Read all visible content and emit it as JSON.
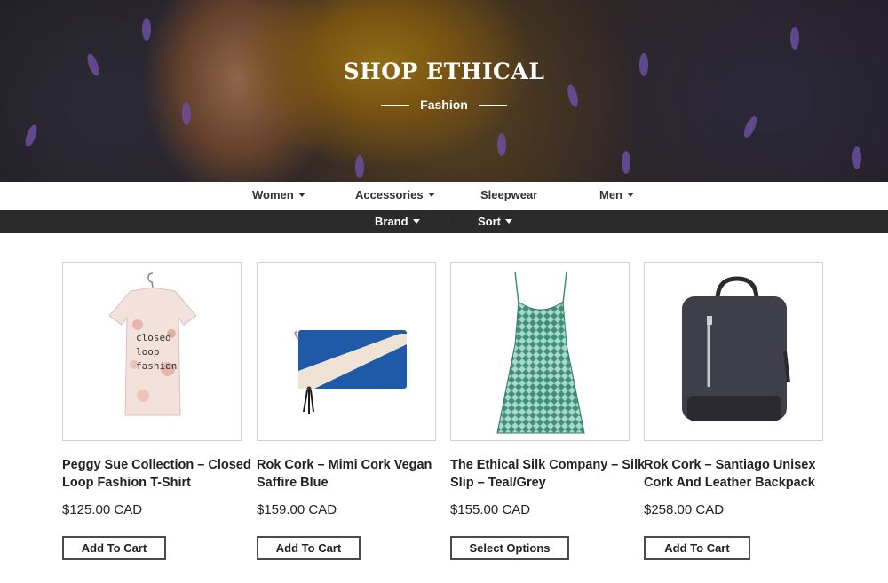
{
  "hero": {
    "title": "SHOP ETHICAL",
    "subtitle": "Fashion"
  },
  "main_nav": {
    "items": [
      {
        "label": "Women",
        "has_dropdown": true
      },
      {
        "label": "Accessories",
        "has_dropdown": true
      },
      {
        "label": "Sleepwear",
        "has_dropdown": false
      },
      {
        "label": "Men",
        "has_dropdown": true
      }
    ]
  },
  "filter_bar": {
    "brand_label": "Brand",
    "separator": "|",
    "sort_label": "Sort"
  },
  "products": [
    {
      "name": "Peggy Sue Collection – Closed Loop Fashion T-Shirt",
      "price": "$125.00 CAD",
      "button": "Add To Cart",
      "image_text": "closed loop fashion",
      "image": "t-shirt"
    },
    {
      "name": "Rok Cork – Mimi Cork Vegan Saffire Blue",
      "price": "$159.00 CAD",
      "button": "Add To Cart",
      "image": "clutch-bag"
    },
    {
      "name": "The Ethical Silk Company – Silk Slip – Teal/Grey",
      "price": "$155.00 CAD",
      "button": "Select Options",
      "image": "silk-slip-dress"
    },
    {
      "name": "Rok Cork – Santiago Unisex Cork And Leather Backpack",
      "price": "$258.00 CAD",
      "button": "Add To Cart",
      "image": "backpack"
    }
  ],
  "colors": {
    "filter_bar_bg": "#2b2b2b",
    "text": "#222222",
    "button_border": "#4a4a4a"
  }
}
